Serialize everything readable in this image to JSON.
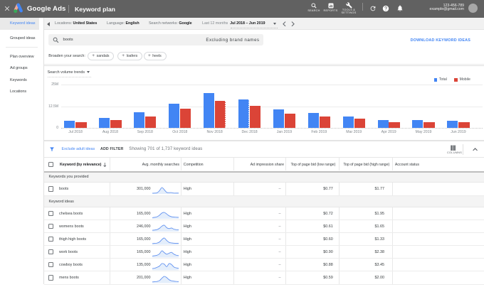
{
  "topbar": {
    "close_label": "×",
    "brand": "Google Ads",
    "page_title": "Keyword plan",
    "nav_items": [
      {
        "icon": "search-icon",
        "label": "SEARCH"
      },
      {
        "icon": "reports-icon",
        "label": "REPORTS"
      },
      {
        "icon": "tools-icon",
        "label": "TOOLS & SETTINGS",
        "label_line1": "TOOLS &",
        "label_line2": "SETTINGS"
      }
    ],
    "quick_icons": [
      "refresh-icon",
      "help-icon",
      "notifications-icon"
    ],
    "account_id": "123-456-789",
    "account_email": "example@gmail.com"
  },
  "sidebar": {
    "items": [
      {
        "label": "Keyword ideas",
        "selected": true
      },
      {
        "label": "Grouped ideas",
        "selected": false
      },
      {
        "label": "Plan overview",
        "selected": false
      },
      {
        "label": "Ad groups",
        "selected": false
      },
      {
        "label": "Keywords",
        "selected": false
      },
      {
        "label": "Locations",
        "selected": false
      }
    ]
  },
  "subheader": {
    "locations_label": "Locations:",
    "locations_value": "United States",
    "language_label": "Language:",
    "language_value": "English",
    "networks_label": "Search networks:",
    "networks_value": "Google",
    "range_label": "Last 12 months",
    "range_value": "Jul 2018 – Jun 2019"
  },
  "search": {
    "query": "boots",
    "excluding": "Excluding brand names",
    "download_link": "DOWNLOAD KEYWORD IDEAS"
  },
  "broaden": {
    "label": "Broaden your search:",
    "chips": [
      "sandals",
      "loafers",
      "heels"
    ]
  },
  "chart_data": {
    "type": "bar",
    "title": "Search volume trends",
    "categories": [
      "Jul 2018",
      "Aug 2018",
      "Sep 2018",
      "Oct 2018",
      "Nov 2018",
      "Dec 2018",
      "Jan 2019",
      "Feb 2019",
      "Mar 2019",
      "Apr 2019",
      "May 2019",
      "Jun 2019"
    ],
    "series": [
      {
        "name": "Total",
        "color": "#4285f4",
        "values": [
          4.3,
          5.8,
          8.9,
          14.1,
          20.1,
          16.4,
          10.6,
          8.5,
          6.7,
          4.7,
          4.5,
          4.1
        ]
      },
      {
        "name": "Mobile",
        "color": "#db4437",
        "values": [
          3.2,
          4.4,
          6.7,
          10.9,
          15.6,
          12.8,
          8.4,
          6.4,
          5.3,
          3.5,
          3.4,
          3.2
        ]
      }
    ],
    "unit": "M",
    "ylim": [
      0,
      25
    ],
    "yticks": [
      {
        "label": "25M",
        "value": 25
      },
      {
        "label": "12.5M",
        "value": 12.5
      },
      {
        "label": "0",
        "value": 0
      }
    ],
    "legend_position": "top-right",
    "grid": true,
    "dashed_edges": [
      {
        "category_index": 4,
        "series_index": 1
      },
      {
        "category_index": 5,
        "series_index": 0
      }
    ]
  },
  "filterbar": {
    "exclude_link": "Exclude adult ideas",
    "add_filter": "ADD FILTER",
    "showing": "Showing 701 of 1,737 keyword ideas",
    "columns_label": "COLUMNS"
  },
  "table": {
    "headers": {
      "keyword": "Keyword (by relevance)",
      "searches": "Avg. monthly searches",
      "competition": "Competition",
      "ad_impression_share": "Ad impression share",
      "bid_low": "Top of page bid (low range)",
      "bid_high": "Top of page bid (high range)",
      "account_status": "Account status"
    },
    "sections": [
      {
        "label": "Keywords you provided"
      },
      {
        "label": "Keyword ideas"
      }
    ],
    "rows": [
      {
        "section": 0,
        "keyword": "boots",
        "searches": "301,000",
        "competition": "High",
        "ad_impression_share": "–",
        "bid_low": "$0.77",
        "bid_high": "$1.77",
        "account_status": "",
        "spark": [
          0.08,
          0.1,
          0.15,
          0.5,
          1.0,
          0.65,
          0.22,
          0.18,
          0.18,
          0.1,
          0.1,
          0.1
        ]
      },
      {
        "section": 1,
        "keyword": "chelsea boots",
        "searches": "165,000",
        "competition": "High",
        "ad_impression_share": "–",
        "bid_low": "$0.72",
        "bid_high": "$1.95",
        "account_status": "",
        "spark": [
          0.15,
          0.2,
          0.3,
          0.55,
          0.9,
          1.0,
          0.75,
          0.45,
          0.3,
          0.25,
          0.22,
          0.2
        ]
      },
      {
        "section": 1,
        "keyword": "womens boots",
        "searches": "246,000",
        "competition": "High",
        "ad_impression_share": "–",
        "bid_low": "$0.61",
        "bid_high": "$1.65",
        "account_status": "",
        "spark": [
          0.18,
          0.22,
          0.3,
          0.5,
          0.85,
          1.0,
          0.6,
          0.45,
          0.55,
          0.35,
          0.28,
          0.25
        ]
      },
      {
        "section": 1,
        "keyword": "thigh high boots",
        "searches": "165,000",
        "competition": "High",
        "ad_impression_share": "–",
        "bid_low": "$0.60",
        "bid_high": "$1.33",
        "account_status": "",
        "spark": [
          0.1,
          0.13,
          0.18,
          0.35,
          0.75,
          1.0,
          0.6,
          0.3,
          0.2,
          0.16,
          0.14,
          0.13
        ]
      },
      {
        "section": 1,
        "keyword": "work boots",
        "searches": "165,000",
        "competition": "High",
        "ad_impression_share": "–",
        "bid_low": "$0.90",
        "bid_high": "$2.38",
        "account_status": "",
        "spark": [
          0.15,
          0.2,
          0.28,
          0.5,
          1.0,
          0.7,
          0.45,
          0.6,
          0.75,
          0.45,
          0.28,
          0.22
        ]
      },
      {
        "section": 1,
        "keyword": "cowboy boots",
        "searches": "135,000",
        "competition": "High",
        "ad_impression_share": "–",
        "bid_low": "$0.88",
        "bid_high": "$3.45",
        "account_status": "",
        "spark": [
          0.2,
          0.25,
          0.4,
          0.6,
          1.0,
          0.9,
          0.5,
          1.0,
          0.85,
          0.45,
          0.3,
          0.25
        ]
      },
      {
        "section": 1,
        "keyword": "mens boots",
        "searches": "201,000",
        "competition": "High",
        "ad_impression_share": "–",
        "bid_low": "$0.59",
        "bid_high": "$2.00",
        "account_status": "",
        "spark": [
          0.1,
          0.13,
          0.18,
          0.32,
          0.7,
          1.0,
          0.8,
          0.45,
          0.28,
          0.22,
          0.18,
          0.16
        ]
      }
    ]
  },
  "colors": {
    "topbar": "#616161",
    "accent_blue": "#4285f4",
    "bar_red": "#db4437",
    "subheader_bg": "#f1f1f1",
    "band_bg": "#f4f4f4"
  }
}
